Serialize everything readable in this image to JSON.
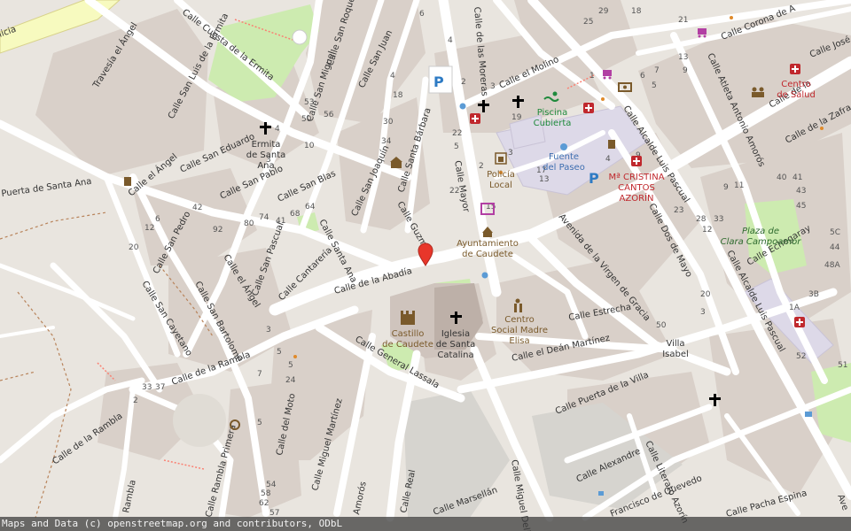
{
  "attribution": "Maps and Data (c) openstreetmap.org and contributors, ODbL",
  "streets": [
    "Calle Cuesta de la Ermita",
    "Travesía el Ángel",
    "Calle San Luis de la Ermita",
    "Calle San Roque",
    "Calle San Miguel",
    "Calle San Juan",
    "Calle de las Moreras",
    "Calle el Molino",
    "Calle Corona de A",
    "Calle José R",
    "Calle Atleta Antonio Amorós",
    "Calle de la Zafra",
    "Calle San Eduardo",
    "Calle San Pablo",
    "Calle San Blas",
    "Calle San Joaquín",
    "Calle Santa Bárbara",
    "Calle Mayor",
    "Calle Alcalde Luis Pascual",
    "Calle de la",
    "Calle Dos de Mayo",
    "Puerta de Santa Ana",
    "Calle el Ángel",
    "Calle San Pedro",
    "Calle el Ángel",
    "Calle San Pascual",
    "Calle Cantarería",
    "Calle Santa Ana",
    "Calle Guzmán",
    "Calle de la Abadía",
    "Avenida de la Virgen de Gracia",
    "Calle Echegaray",
    "Calle Alcalde Luis Pascual",
    "Calle San Cayetano",
    "Calle San Bartolomé",
    "Calle Estrecha",
    "Calle General Lassala",
    "Calle el Deán Martínez",
    "Calle de la Rambla",
    "Calle Puerta de la Villa",
    "Calle de la Rambla",
    "Calle del Moto",
    "Calle Miguel Martínez",
    "Calle Real",
    "Calle Alexandre",
    "Calle Literato Azorín",
    "Calle Miguel Delib",
    "Rambla",
    "Calle Rambla Primera",
    "Calle Marsellán",
    "Amorós",
    "Francisco de Quevedo",
    "Calle Pacha Espina",
    "Ave",
    "licia"
  ],
  "pois": [
    {
      "label1": "Ermita",
      "label2": "de Santa",
      "label3": "Ana",
      "icon": "cross-icon"
    },
    {
      "label1": "Piscina",
      "label2": "Cubierta",
      "icon": "swimming-icon"
    },
    {
      "label1": "Fuente",
      "label2": "del Paseo",
      "icon": "fountain-icon"
    },
    {
      "label1": "Policía",
      "label2": "Local",
      "icon": "police-icon"
    },
    {
      "label1": "Ayuntamiento",
      "label2": "de Caudete",
      "icon": "townhall-icon"
    },
    {
      "label1": "Mª CRISTINA",
      "label2": "CANTOS",
      "label3": "AZORÍN",
      "icon": "pharmacy-icon"
    },
    {
      "label1": "Centro",
      "label2": "de Salud",
      "icon": "health-icon"
    },
    {
      "label1": "Castillo",
      "label2": "de Caudete",
      "icon": "castle-icon"
    },
    {
      "label1": "Iglesia",
      "label2": "de Santa",
      "label3": "Catalina",
      "icon": "church-icon"
    },
    {
      "label1": "Centro",
      "label2": "Social Madre",
      "label3": "Elisa",
      "icon": "community-icon"
    },
    {
      "label1": "Villa",
      "label2": "Isabel"
    }
  ],
  "park": {
    "label1": "Plaza de",
    "label2": "Clara Campoamor"
  },
  "parking": [
    "P",
    "P"
  ],
  "house_numbers": [
    "6",
    "4",
    "2",
    "53",
    "50",
    "56",
    "4",
    "18",
    "22",
    "30",
    "34",
    "10",
    "5",
    "3",
    "2",
    "4",
    "1",
    "9",
    "29",
    "21",
    "18",
    "25",
    "13",
    "6",
    "9",
    "7",
    "5",
    "4",
    "22",
    "19",
    "17",
    "15",
    "3",
    "13",
    "3",
    "42",
    "92",
    "80",
    "74",
    "41",
    "68",
    "64",
    "6",
    "12",
    "20",
    "23",
    "28",
    "33",
    "11",
    "9",
    "12",
    "40",
    "41",
    "43",
    "45",
    "5C",
    "44",
    "48A",
    "3B",
    "1A",
    "52",
    "51",
    "20",
    "3",
    "50",
    "3",
    "5",
    "24",
    "33",
    "37",
    "2",
    "5",
    "7",
    "5",
    "54",
    "58",
    "62",
    "57"
  ],
  "marker": {
    "color": "#e8362a"
  },
  "colors": {
    "background": "#e9e5df",
    "building": "#d9d0c9",
    "road": "#ffffff",
    "park": "#cdebb0",
    "pedestrian": "#ddd9e8",
    "highway": "#f7fabf"
  }
}
